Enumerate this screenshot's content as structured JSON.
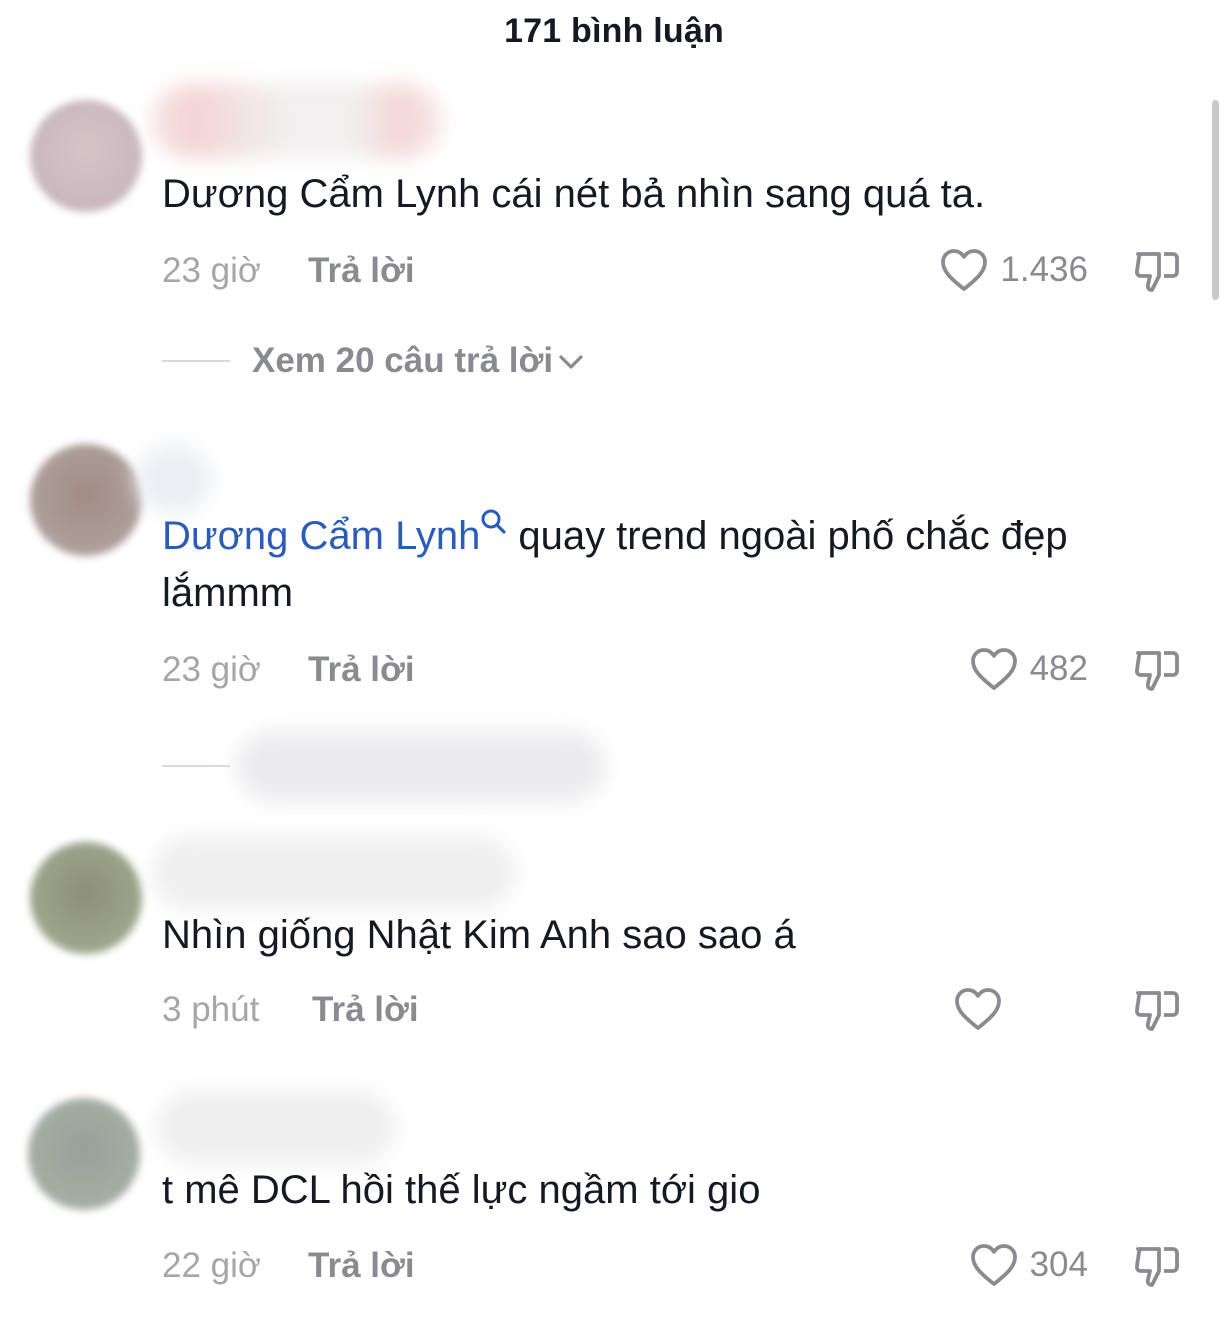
{
  "header": {
    "title": "171 bình luận"
  },
  "comments": [
    {
      "text": "Dương Cẩm Lynh cái nét bả nhìn sang quá ta.",
      "time": "23 giờ",
      "reply_label": "Trả lời",
      "likes": "1.436",
      "replies_label": "Xem 20 câu trả lời"
    },
    {
      "mention": "Dương Cẩm Lynh",
      "text": "quay trend ngoài phố chắc đẹp lắmmm",
      "time": "23 giờ",
      "reply_label": "Trả lời",
      "likes": "482"
    },
    {
      "text": "Nhìn giống Nhật Kim Anh sao sao á",
      "time": "3 phút",
      "reply_label": "Trả lời",
      "likes": ""
    },
    {
      "text": "t mê DCL hồi thế lực ngầm tới gio",
      "time": "22 giờ",
      "reply_label": "Trả lời",
      "likes": "304"
    }
  ],
  "icons": {
    "like": "heart-outline-icon",
    "dislike": "thumbs-down-icon",
    "expand": "chevron-down-icon",
    "mention": "search-icon"
  },
  "colors": {
    "text": "#161823",
    "secondary": "#8a8b91",
    "mention": "#2b5db8"
  }
}
